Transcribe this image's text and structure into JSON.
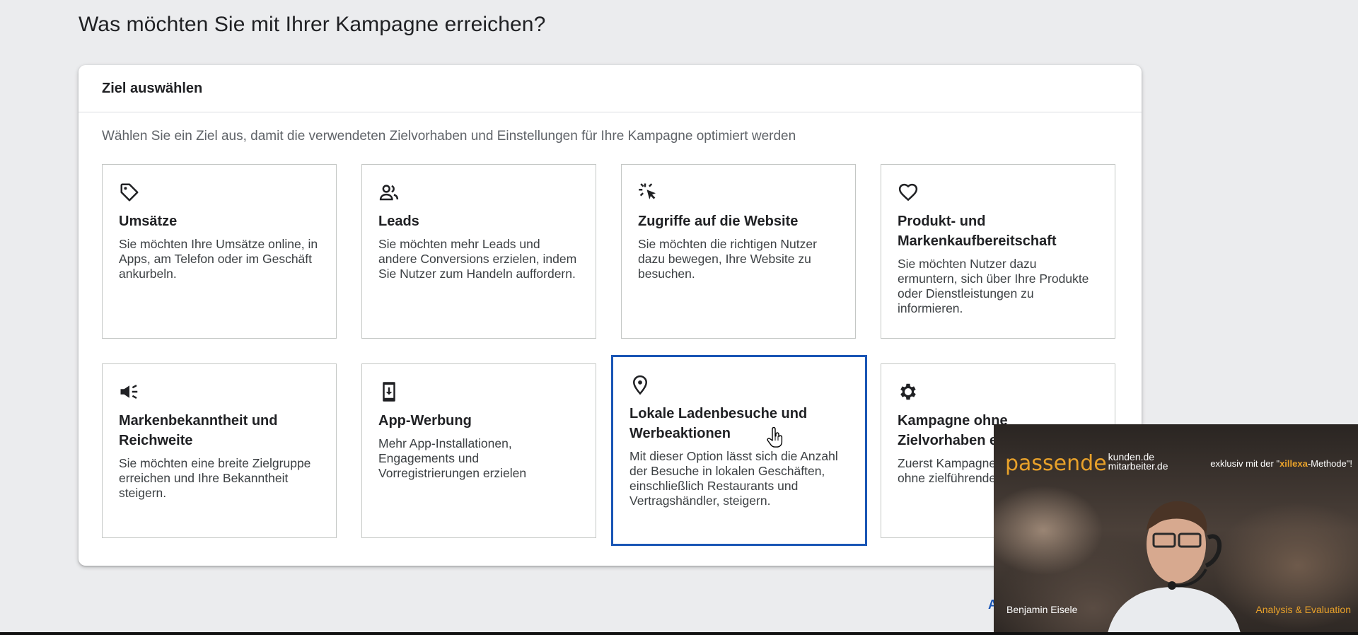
{
  "page_title": "Was möchten Sie mit Ihrer Kampagne erreichen?",
  "panel": {
    "header": "Ziel auswählen",
    "instruction": "Wählen Sie ein Ziel aus, damit die verwendeten Zielvorhaben und Einstellungen für Ihre Kampagne optimiert werden"
  },
  "cards": [
    {
      "icon": "tag-icon",
      "title": "Umsätze",
      "desc": "Sie möchten Ihre Umsätze online, in Apps, am Telefon oder im Geschäft ankurbeln."
    },
    {
      "icon": "people-icon",
      "title": "Leads",
      "desc": "Sie möchten mehr Leads und andere Conversions erzielen, indem Sie Nutzer zum Handeln auffordern."
    },
    {
      "icon": "cursor-click-icon",
      "title": "Zugriffe auf die Website",
      "desc": "Sie möchten die richtigen Nutzer dazu bewegen, Ihre Website zu besuchen."
    },
    {
      "icon": "heart-icon",
      "title": "Produkt- und Markenkaufbereitschaft",
      "desc": "Sie möchten Nutzer dazu ermuntern, sich über Ihre Produkte oder Dienstleistungen zu informieren."
    },
    {
      "icon": "megaphone-icon",
      "title": "Markenbekanntheit und Reichweite",
      "desc": "Sie möchten eine breite Zielgruppe erreichen und Ihre Bekanntheit steigern."
    },
    {
      "icon": "phone-download-icon",
      "title": "App-Werbung",
      "desc": "Mehr App-Installationen, Engagements und Vorregistrierungen erzielen"
    },
    {
      "icon": "location-pin-icon",
      "title": "Lokale Ladenbesuche und Werbeaktionen",
      "desc": "Mit dieser Option lässt sich die Anzahl der Besuche in lokalen Geschäften, einschließlich Restaurants und Vertragshändler, steigern.",
      "selected": true
    },
    {
      "icon": "gear-icon",
      "title": "Kampagne ohne Zielvorhaben erstellen",
      "desc": "Zuerst Kampagnentyp auswählen, ohne zielführende Empfehlungen"
    }
  ],
  "video_overlay": {
    "brand_main": "passende",
    "brand_line1": "kunden.de",
    "brand_line2": "mitarbeiter.de",
    "tagline_pre": "exklusiv mit der \"",
    "tagline_brand": "xillexa",
    "tagline_post": "-Methode\"!",
    "name": "Benjamin Eisele",
    "caption": "Analysis & Evaluation"
  },
  "colors": {
    "selected_border": "#1a56b5",
    "brand_orange": "#e8a12a"
  }
}
